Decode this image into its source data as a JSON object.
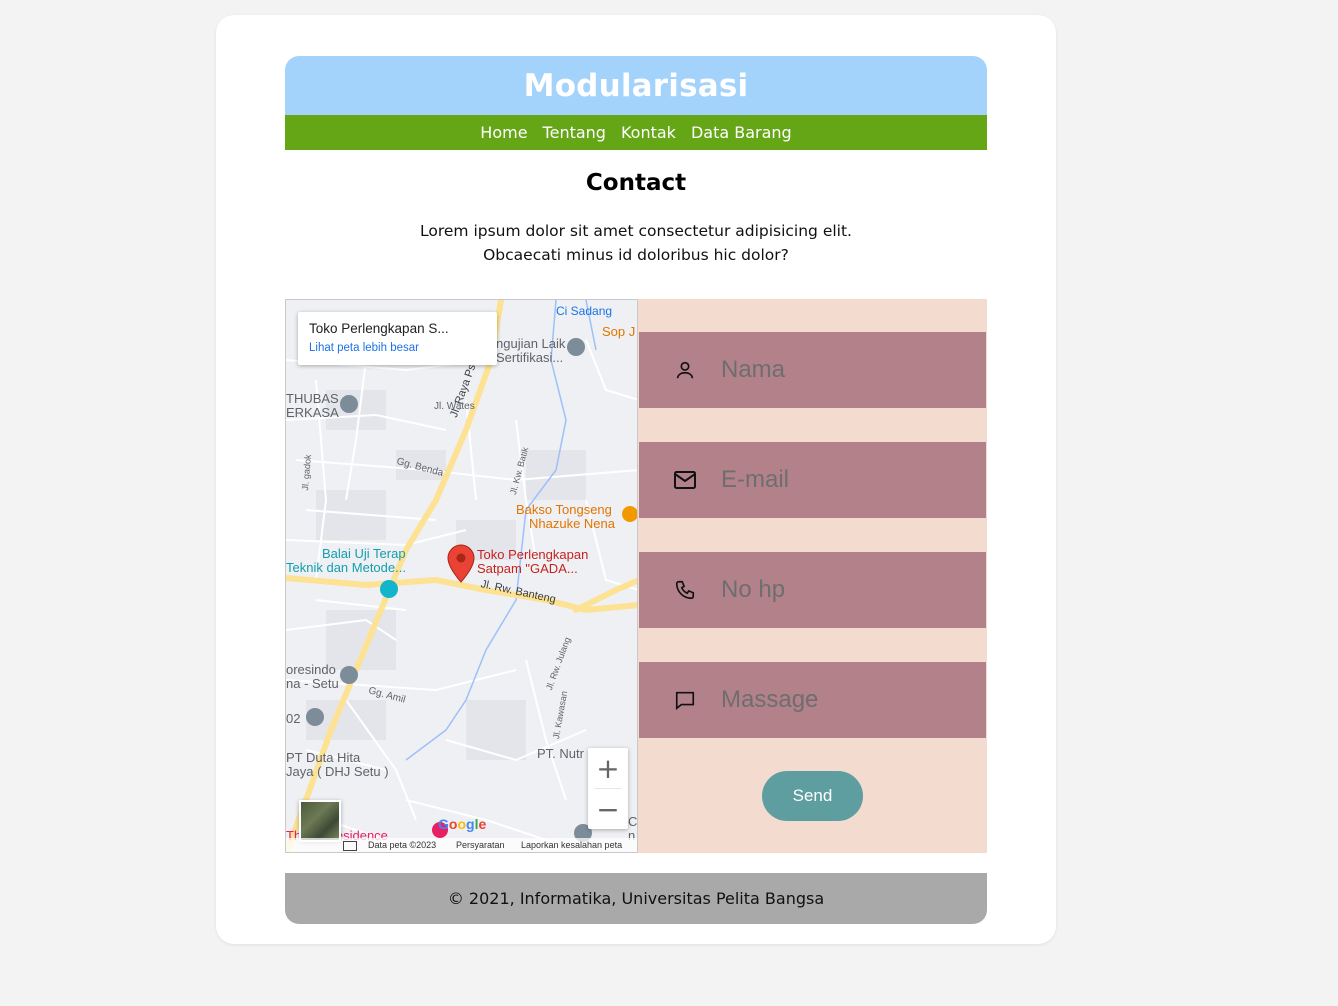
{
  "header": {
    "title": "Modularisasi"
  },
  "nav": [
    "Home",
    "Tentang",
    "Kontak",
    "Data Barang"
  ],
  "main": {
    "title": "Contact",
    "description": "Lorem ipsum dolor sit amet consectetur adipisicing elit. Obcaecati minus id doloribus hic dolor?"
  },
  "map": {
    "place_title": "Toko Perlengkapan S...",
    "view_larger_link": "Lihat peta lebih besar",
    "labels": {
      "ci_sadang": "Ci Sadang",
      "sop": "Sop J",
      "pengujian_1": "ngujian Laik",
      "pengujian_2": "Sertifikasi...",
      "thubas_1": "THUBAS",
      "thubas_2": "ERKASA",
      "jl_wates": "Jl. Wates",
      "jl_raya": "Jl. Raya Ps. Setu",
      "jl_gadok": "Jl. gadok",
      "gg_benda": "Gg. Benda",
      "jl_kw_batik": "Jl. Kw. Batik",
      "bakso_1": "Bakso Tongseng",
      "bakso_2": "Nhazuke Nena",
      "balai_1": "Balai Uji Terap",
      "balai_2": "Teknik dan Metode...",
      "toko_1": "Toko Perlengkapan",
      "toko_2": "Satpam \"GADA...",
      "jl_rw_banteng": "Jl. Rw. Banteng",
      "jl_rw_julang": "Jl. Rw. Julang",
      "presindo_1": "oresindo",
      "presindo_2": "na - Setu",
      "gg_amil": "Gg. Amil",
      "num_02": "02",
      "jl_kawasan": "Jl. Kawasan",
      "pt_nutr": "PT. Nutr",
      "pt_duta_1": "PT Duta Hita",
      "pt_duta_2": "Jaya ( DHJ Setu )",
      "residence": "Thabo Residence",
      "c_label": "C",
      "n_label": "n"
    },
    "zoom_in": "+",
    "zoom_out": "−",
    "google": "Google",
    "footer": {
      "data": "Data peta ©2023",
      "terms": "Persyaratan",
      "report": "Laporkan kesalahan peta"
    }
  },
  "form": {
    "name_placeholder": "Nama",
    "email_placeholder": "E-mail",
    "phone_placeholder": "No hp",
    "message_placeholder": "Massage",
    "send_label": "Send"
  },
  "footer": {
    "text": "© 2021, Informatika, Universitas Pelita Bangsa"
  },
  "colors": {
    "header_bg": "#a3d3fb",
    "nav_bg": "#65a617",
    "form_bg": "#f3dbd0",
    "field_bg": "#b3818a",
    "send_bg": "#5e9ea0",
    "footer_bg": "#a9a9a9"
  }
}
